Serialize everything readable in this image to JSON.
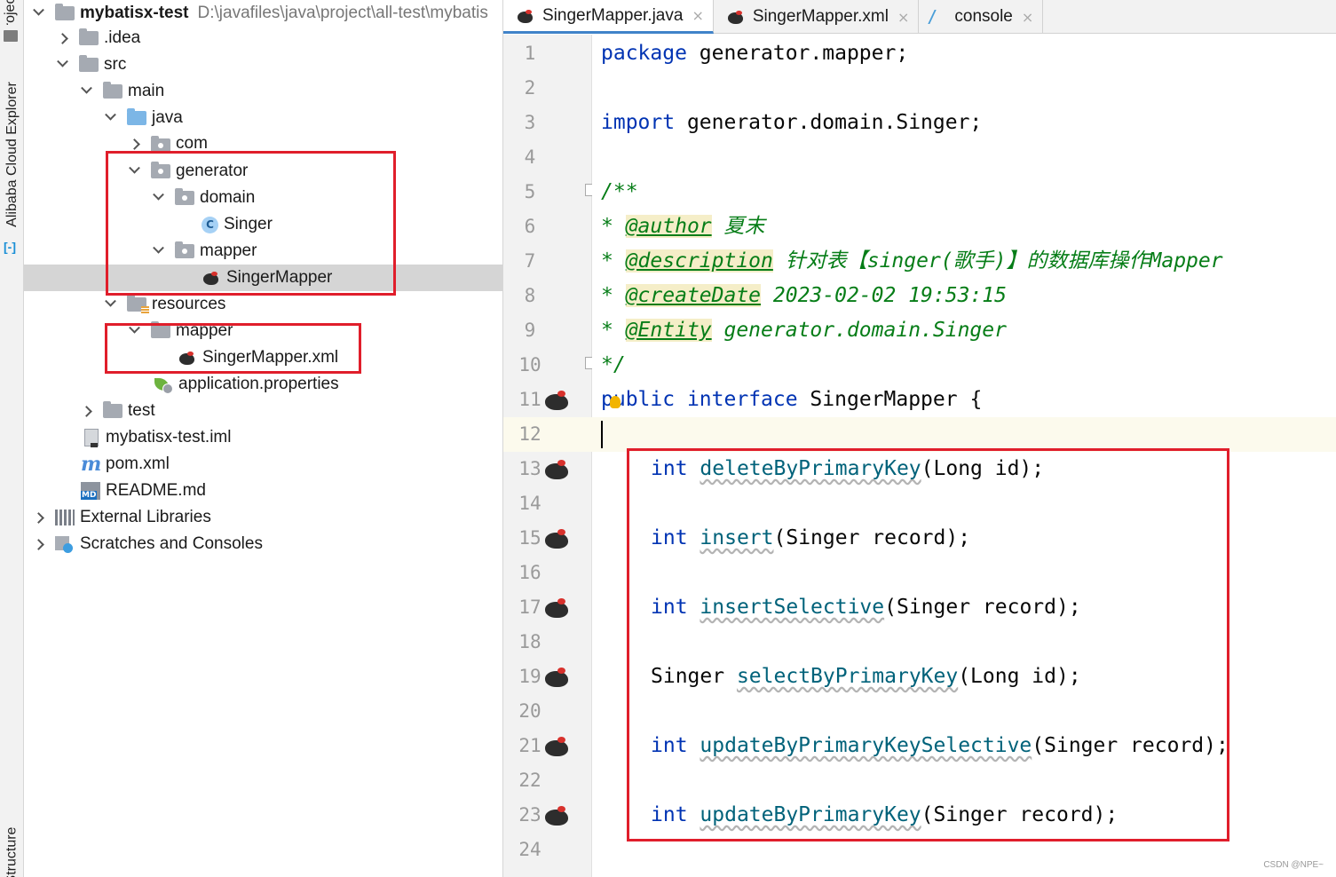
{
  "side_strip": {
    "project_label": "Project",
    "cloud_label": "Alibaba Cloud Explorer",
    "structure_label": "Structure"
  },
  "tree": {
    "root_label": "mybatisx-test",
    "root_path": "D:\\javafiles\\java\\project\\all-test\\mybatis",
    "idea": ".idea",
    "src": "src",
    "main": "main",
    "java": "java",
    "com": "com",
    "generator": "generator",
    "domain": "domain",
    "singer": "Singer",
    "mapper_pkg": "mapper",
    "singer_mapper": "SingerMapper",
    "resources": "resources",
    "mapper_res": "mapper",
    "singer_mapper_xml": "SingerMapper.xml",
    "app_props": "application.properties",
    "test": "test",
    "iml": "mybatisx-test.iml",
    "pom": "pom.xml",
    "readme": "README.md",
    "external_libs": "External Libraries",
    "scratches": "Scratches and Consoles"
  },
  "tabs": [
    {
      "label": "SingerMapper.java",
      "close": "×",
      "active": true
    },
    {
      "label": "SingerMapper.xml",
      "close": "×",
      "active": false
    },
    {
      "label": "console",
      "close": "×",
      "active": false
    }
  ],
  "editor": {
    "line_numbers": [
      "1",
      "2",
      "3",
      "4",
      "5",
      "6",
      "7",
      "8",
      "9",
      "10",
      "11",
      "12",
      "13",
      "14",
      "15",
      "16",
      "17",
      "18",
      "19",
      "20",
      "21",
      "22",
      "23",
      "24"
    ],
    "current_line": 12,
    "code": {
      "l1_kw": "package",
      "l1_rest": " generator.mapper;",
      "l3_kw": "import",
      "l3_rest": " generator.domain.Singer;",
      "l5": "/**",
      "l6_star": "* ",
      "l6_tag": "@author",
      "l6_val": " 夏末",
      "l7_star": "* ",
      "l7_tag": "@description",
      "l7_val": " 针对表【singer(歌手)】的数据库操作Mapper",
      "l8_star": "* ",
      "l8_tag": "@createDate",
      "l8_val": " 2023-02-02 19:53:15",
      "l9_star": "* ",
      "l9_tag": "@Entity",
      "l9_val": " generator.domain.Singer",
      "l10": "*/",
      "l11_kw1": "public",
      "l11_kw2": "interface",
      "l11_rest": " SingerMapper {",
      "m1_type": "int",
      "m1_name": "deleteByPrimaryKey",
      "m1_args": "(Long id);",
      "m2_type": "int",
      "m2_name": "insert",
      "m2_args": "(Singer record);",
      "m3_type": "int",
      "m3_name": "insertSelective",
      "m3_args": "(Singer record);",
      "m4_type": "Singer",
      "m4_name": "selectByPrimaryKey",
      "m4_args": "(Long id);",
      "m5_type": "int",
      "m5_name": "updateByPrimaryKeySelective",
      "m5_args": "(Singer record);",
      "m6_type": "int",
      "m6_name": "updateByPrimaryKey",
      "m6_args": "(Singer record);"
    }
  },
  "watermark": "CSDN @NPE~",
  "colors": {
    "highlight_box": "#e01e2b",
    "keyword": "#0033b3",
    "doc_comment": "#067d17",
    "method_name": "#00627a",
    "selection": "#d5d5d5"
  }
}
